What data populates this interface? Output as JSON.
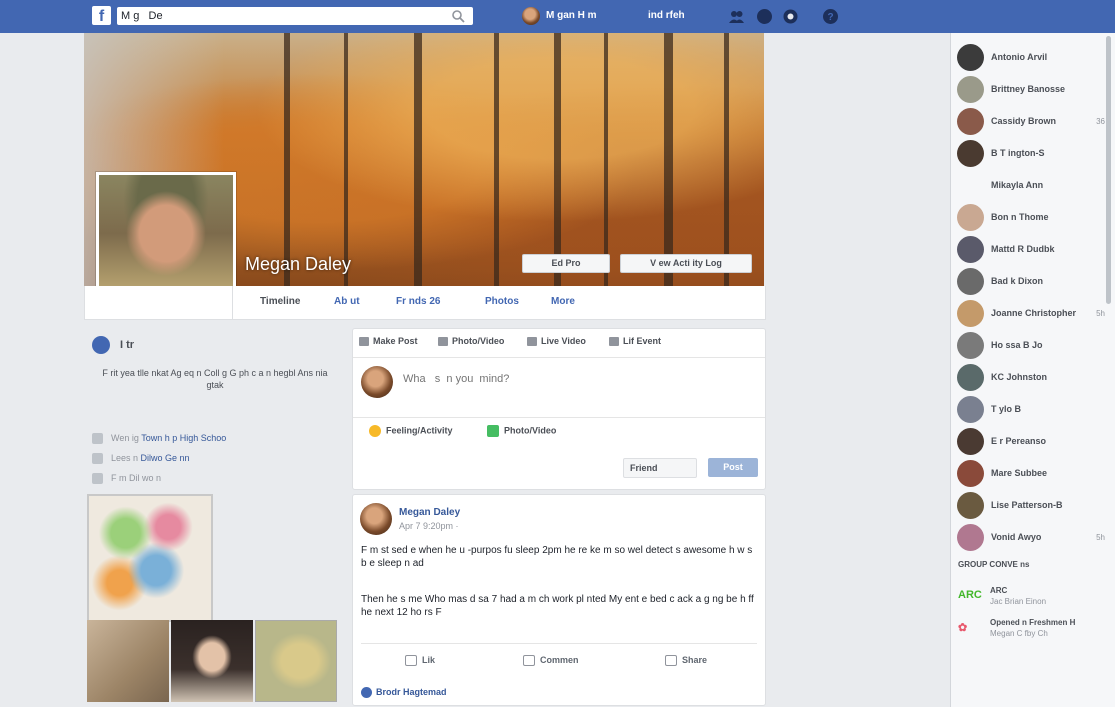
{
  "topbar": {
    "logo": "f",
    "search_value": "M g   De",
    "user_name": "M  gan    H  m",
    "home_label": "ind  rfeh"
  },
  "profile": {
    "name": "Megan Daley",
    "edit_profile": "Ed    Pro",
    "view_activity": "V ew Acti  ity Log"
  },
  "tabs": [
    "Timeline",
    "Ab  ut",
    "Fr  nds  26",
    "Photos",
    "More"
  ],
  "intro": {
    "title": "I  tr",
    "bio": "F rit yea tlle   nkat Ag  eq  n Coll g    G  ph c   a  n  hegbl    Ans    nia    gtak",
    "info": [
      {
        "text": "Wen        ig       ",
        "link": "Town  h p High Schoo"
      },
      {
        "text": "Lees  n ",
        "link": "Dilwo   Ge  nn"
      },
      {
        "text": "F   m Dil  wo   n",
        "link": ""
      }
    ]
  },
  "composer": {
    "tabs": [
      "Make Post",
      "Photo/Video",
      "Live Video",
      "Lif   Event"
    ],
    "placeholder": "Wha   s  n you  mind?",
    "actions": [
      "Feeling/Activity",
      "Photo/Video"
    ],
    "audience": "Friend",
    "post": "Post"
  },
  "post": {
    "author": "Megan Daley",
    "time": "Apr  7     9:20pm  ·",
    "para1": "F    m  st sed e  when  he  u  -purpos  fu    sleep       2pm   he  re   ke          m  so wel   detect   s awesome   h     w  s  b  e     sleep  n  ad",
    "para2": "Then   he  s me          Who  mas  d     sa 7  had  a    m  ch work pl  nted   My ent  e bed  c ack  a  g  ng     be  h         ff       he next 12   ho  rs  F",
    "actions": [
      "Lik",
      "Commen",
      "Share"
    ],
    "reactions": "Brodr    Hagtemad"
  },
  "chat": {
    "contacts": [
      {
        "name": "Antonio Arvil",
        "status": "",
        "color": "#3b3b3b"
      },
      {
        "name": "Brittney Banosse",
        "status": "",
        "color": "#9a9a8a"
      },
      {
        "name": "Cassidy Brown",
        "status": "36",
        "color": "#8a5a4a"
      },
      {
        "name": "B      T  ington-S",
        "status": "",
        "color": "#4a3a30"
      },
      {
        "name": "Mikayla Ann",
        "status": "",
        "color": "#f6f7f9"
      },
      {
        "name": "Bon    n Thome",
        "status": "",
        "color": "#c9a892"
      },
      {
        "name": "Mattd      R  Dudbk",
        "status": "",
        "color": "#5a5a6a"
      },
      {
        "name": "Bad  k Dixon",
        "status": "",
        "color": "#6a6a6a"
      },
      {
        "name": "Joanne Christopher",
        "status": "5h",
        "color": "#c49a6a"
      },
      {
        "name": "Ho  ssa B      Jo",
        "status": "",
        "color": "#7a7a7a"
      },
      {
        "name": "KC Johnston",
        "status": "",
        "color": "#5a6a6a"
      },
      {
        "name": "T  ylo   B",
        "status": "",
        "color": "#7a8090"
      },
      {
        "name": "E  r   Pereanso",
        "status": "",
        "color": "#4a3a32"
      },
      {
        "name": "Mare Subbee",
        "status": "",
        "color": "#8a4a3a"
      },
      {
        "name": "Lise Patterson-B",
        "status": "",
        "color": "#6a5a40"
      },
      {
        "name": "Vonid   Awyo",
        "status": "5h",
        "color": "#b07890"
      }
    ],
    "groups_header": "GROUP CONVE      ns",
    "groups": [
      {
        "icon": "ARC",
        "name": "ARC",
        "members": "Jac        Brian Einon"
      },
      {
        "icon": "✿",
        "name": "Opened    n Freshmen H",
        "members": "Megan C      fby Ch"
      }
    ]
  }
}
